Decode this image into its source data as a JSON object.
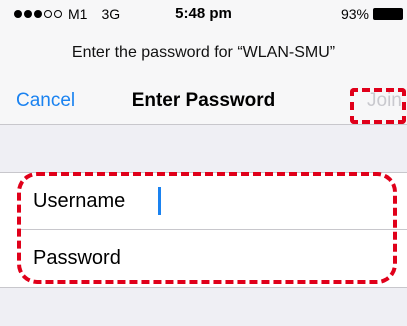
{
  "status_bar": {
    "signal_dots": {
      "filled": 3,
      "empty": 2
    },
    "carrier": "M1",
    "network": "3G",
    "time": "5:48 pm",
    "battery": "93%"
  },
  "prompt": "Enter the password for “WLAN-SMU”",
  "nav": {
    "cancel_label": "Cancel",
    "title": "Enter Password",
    "join_label": "Join"
  },
  "form": {
    "username_label": "Username",
    "username_value": "",
    "password_label": "Password",
    "password_value": ""
  },
  "colors": {
    "accent": "#1a82f0",
    "disabled": "#c9c9ce",
    "highlight": "#e0001a"
  }
}
